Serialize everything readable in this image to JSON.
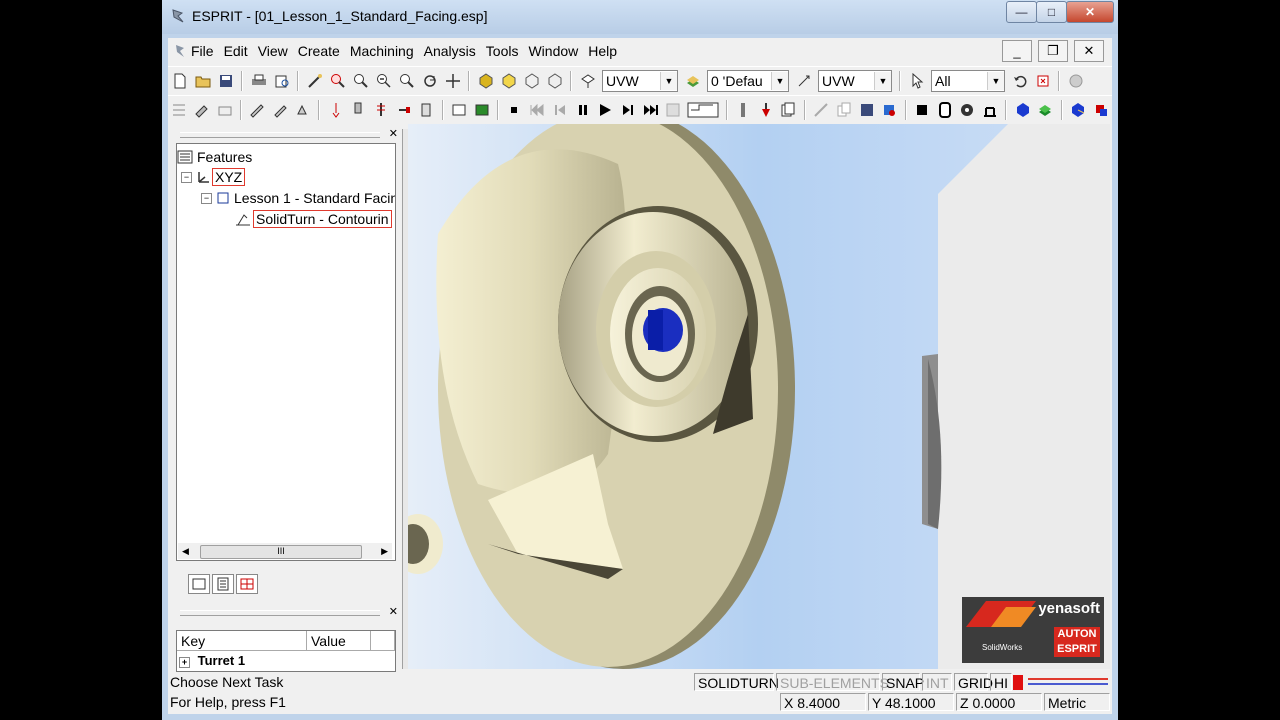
{
  "window": {
    "title": "ESPRIT - [01_Lesson_1_Standard_Facing.esp]",
    "minimize_glyph": "—",
    "maximize_glyph": "□",
    "close_glyph": "✕"
  },
  "menu": {
    "items": [
      "File",
      "Edit",
      "View",
      "Create",
      "Machining",
      "Analysis",
      "Tools",
      "Window",
      "Help"
    ],
    "mdi_minimize": "_",
    "mdi_restore": "❐",
    "mdi_close": "✕"
  },
  "toolbar": {
    "workplane_value": "UVW",
    "layer_value": "0 'Defau",
    "view_value": "UVW",
    "filter_value": "All"
  },
  "features": {
    "title": "Features",
    "nodes": [
      {
        "label": "XYZ",
        "icon": "axes-icon",
        "highlighted": true
      },
      {
        "label": "Lesson 1 - Standard Facin",
        "icon": "setup-icon",
        "highlighted": false
      },
      {
        "label": "SolidTurn - Contourin",
        "icon": "operation-icon",
        "highlighted": true
      }
    ],
    "scroll_thumb": "III"
  },
  "properties": {
    "columns": [
      "Key",
      "Value"
    ],
    "first_row": "Turret 1"
  },
  "status": {
    "message": "Choose Next Task",
    "help": "For Help, press F1",
    "panes": {
      "solidturn": "SOLIDTURN",
      "subelements": "SUB-ELEMENTS",
      "snap": "SNAP",
      "int": "INT",
      "grid": "GRID",
      "hi": "HI"
    },
    "x": "X 8.4000",
    "y": "Y 48.1000",
    "z": "Z 0.0000",
    "units": "Metric"
  },
  "logo": {
    "brand": "yenasoft",
    "product_line1": "AUTON",
    "product_line2": "ESPRIT",
    "partner": "SolidWorks"
  },
  "colors": {
    "part": "#d8d2b0",
    "part_dark": "#8f8a6a",
    "background_sky": "#b3d0f2",
    "highlight": "#e03a2e"
  }
}
